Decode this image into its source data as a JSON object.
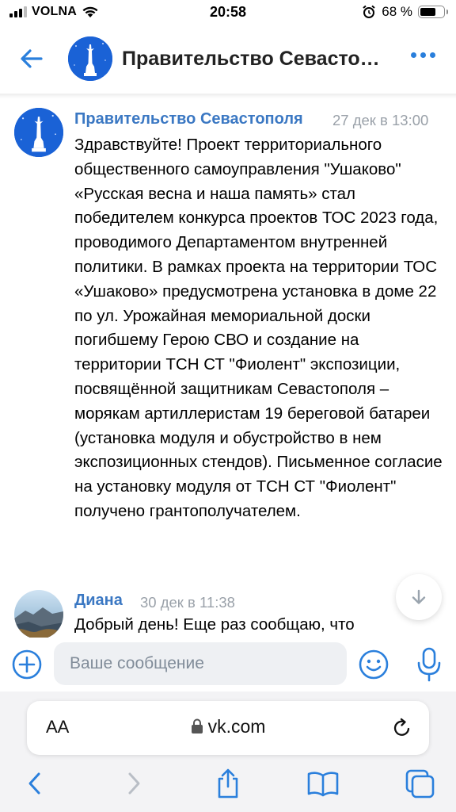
{
  "status_bar": {
    "carrier": "VOLNA",
    "time": "20:58",
    "battery_percent": "68 %",
    "battery_level": 0.68
  },
  "header": {
    "back_icon": "arrow-left-icon",
    "title": "Правительство Севастополя",
    "more_icon": "more-dots-icon",
    "accent_color": "#2a7fdc"
  },
  "messages": [
    {
      "author": "Правительство Севастополя",
      "time": "27 дек в 13:00",
      "text": "Здравствуйте! Проект территориального общественного самоуправления \"Ушаково\" «Русская весна и наша память» стал победителем конкурса проектов ТОС 2023 года, проводимого Департаментом внутренней политики. В рамках проекта на территории ТОС «Ушаково» предусмотрена установка в доме 22 по ул. Урожайная мемориальной доски погибшему Герою СВО и создание на территории ТСН СТ \"Фиолент\" экспозиции, посвящённой защитникам Севастополя – морякам артиллеристам 19 береговой батареи (установка модуля и обустройство в нем экспозиционных стендов). Письменное согласие на установку модуля от ТСН СТ \"Фиолент\" получено грантополучателем."
    },
    {
      "author": "Диана",
      "time": "30 дек в 11:38",
      "text": "Добрый день! Еще раз сообщаю, что"
    }
  ],
  "composer": {
    "placeholder": "Ваше сообщение"
  },
  "browser": {
    "text_size_label": "AA",
    "url": "vk.com"
  }
}
